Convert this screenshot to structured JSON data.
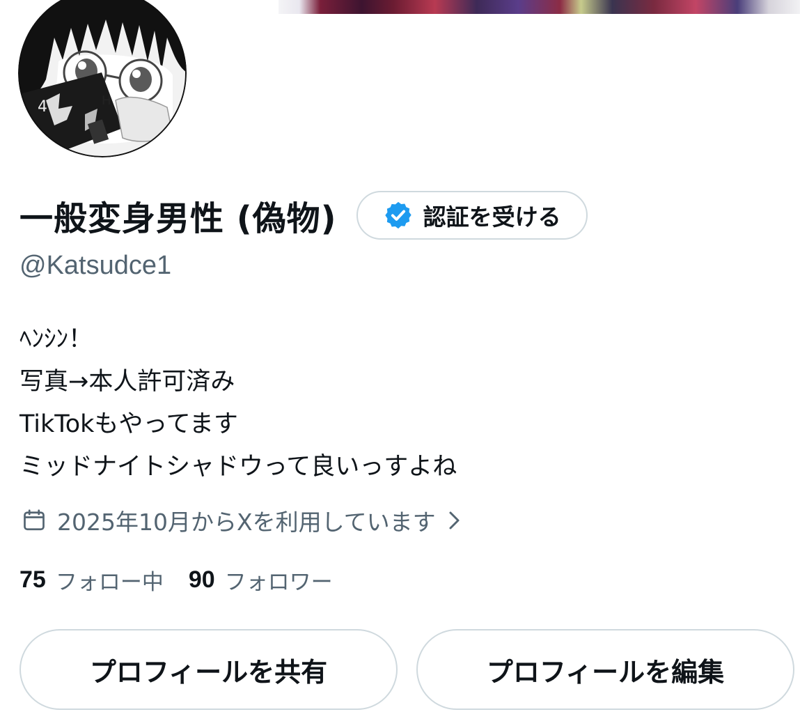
{
  "profile": {
    "display_name": "一般変身男性 (偽物)",
    "handle": "@Katsudce1",
    "verify_button_label": "認証を受ける",
    "bio_lines": [
      "ﾍﾝｼﾝ！",
      "写真→本人許可済み",
      "TikTokもやってます",
      "ミッドナイトシャドウって良いっすよね"
    ],
    "joined_text": "2025年10月からXを利用しています",
    "following_count": "75",
    "following_label": "フォロー中",
    "followers_count": "90",
    "followers_label": "フォロワー"
  },
  "actions": {
    "share_label": "プロフィールを共有",
    "edit_label": "プロフィールを編集"
  },
  "icons": {
    "verified": "verified-badge-icon",
    "calendar": "calendar-icon",
    "chevron": "chevron-right-icon"
  },
  "colors": {
    "verified_blue": "#1d9bf0",
    "secondary_text": "#536471",
    "primary_text": "#0f1419",
    "border": "#cfd9de"
  }
}
